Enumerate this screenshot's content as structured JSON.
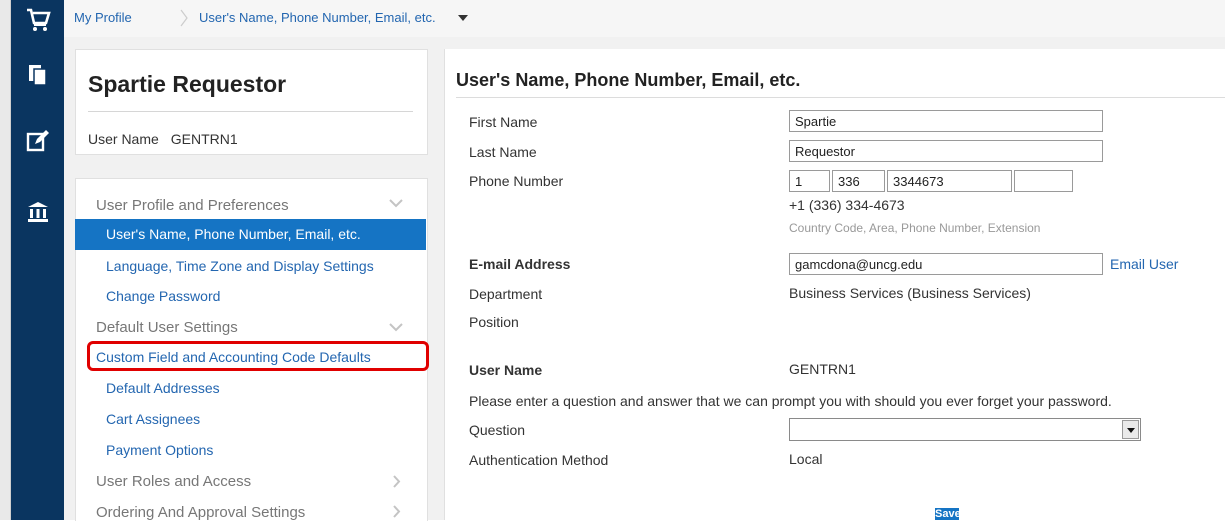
{
  "breadcrumb": {
    "root": "My Profile",
    "current": "User's Name, Phone Number, Email, etc."
  },
  "rail": {
    "icons": [
      "cart-icon",
      "documents-icon",
      "edit-icon",
      "institution-icon"
    ]
  },
  "profile_card": {
    "name": "Spartie Requestor",
    "username_label": "User Name",
    "username_value": "GENTRN1"
  },
  "nav": {
    "sections": [
      {
        "label": "User Profile and Preferences",
        "chevron": "chevron-down",
        "items": [
          {
            "label": "User's Name, Phone Number, Email, etc.",
            "active": true
          },
          {
            "label": "Language, Time Zone and Display Settings"
          },
          {
            "label": "Change Password"
          }
        ]
      },
      {
        "label": "Default User Settings",
        "chevron": "chevron-down",
        "items": [
          {
            "label": "Custom Field and Accounting Code Defaults",
            "highlighted": true
          },
          {
            "label": "Default Addresses"
          },
          {
            "label": "Cart Assignees"
          },
          {
            "label": "Payment Options"
          }
        ]
      },
      {
        "label": "User Roles and Access",
        "chevron": "chevron-right",
        "items": []
      },
      {
        "label": "Ordering And Approval Settings",
        "chevron": "chevron-right",
        "items": []
      }
    ]
  },
  "form": {
    "title": "User's Name, Phone Number, Email, etc.",
    "first_name": {
      "label": "First Name",
      "value": "Spartie"
    },
    "last_name": {
      "label": "Last Name",
      "value": "Requestor"
    },
    "phone": {
      "label": "Phone Number",
      "country": "1",
      "area": "336",
      "number": "3344673",
      "extension": "",
      "formatted": "+1 (336) 334-4673",
      "hint": "Country Code, Area, Phone Number, Extension"
    },
    "email": {
      "label": "E-mail Address",
      "value": "gamcdona@uncg.edu",
      "link": "Email User"
    },
    "department": {
      "label": "Department",
      "value": "Business Services (Business Services)"
    },
    "position": {
      "label": "Position",
      "value": ""
    },
    "user_name": {
      "label": "User Name",
      "value": "GENTRN1"
    },
    "prompt_text": "Please enter a question and answer that we can prompt you with should you ever forget your password.",
    "question": {
      "label": "Question",
      "value": ""
    },
    "auth": {
      "label": "Authentication Method",
      "value": "Local"
    },
    "save_label": "Save"
  },
  "colors": {
    "rail": "#0a3560",
    "link": "#2366b0",
    "active": "#1574c4",
    "highlight": "#e00000"
  }
}
